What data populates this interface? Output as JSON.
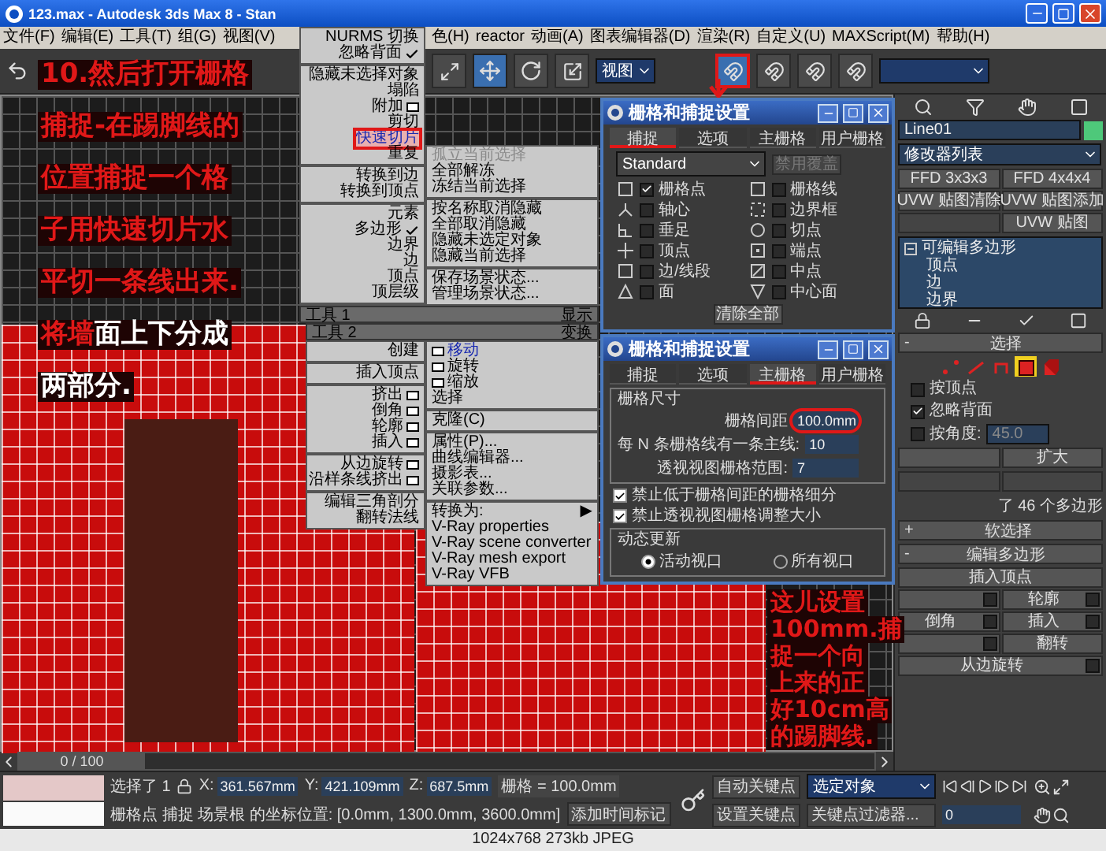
{
  "window": {
    "title": "123.max - Autodesk 3ds Max 8 - Stan"
  },
  "menu_bar": {
    "left": [
      "文件(F)",
      "编辑(E)",
      "工具(T)",
      "组(G)",
      "视图(V)"
    ],
    "right": [
      "色(H)",
      "reactor",
      "动画(A)",
      "图表编辑器(D)",
      "渲染(R)",
      "自定义(U)",
      "MAXScript(M)",
      "帮助(H)"
    ]
  },
  "toolbar": {
    "view_dropdown": "视图",
    "snap_toggles": [
      {
        "selected": true
      },
      {
        "selected": false
      },
      {
        "selected": false
      },
      {
        "selected": false
      }
    ]
  },
  "quad_menu": {
    "top_left": [
      [
        {
          "label": "NURMS 切换",
          "checked": false,
          "box": false,
          "highlighted": false,
          "disabled": false,
          "circled": false
        },
        {
          "label": "忽略背面",
          "checked": true,
          "box": false,
          "highlighted": false,
          "disabled": false,
          "circled": false
        }
      ],
      [
        {
          "label": "隐藏未选择对象",
          "checked": false,
          "box": false,
          "highlighted": false,
          "disabled": false,
          "circled": false
        },
        {
          "label": "塌陷",
          "checked": false,
          "box": false,
          "highlighted": false,
          "disabled": false,
          "circled": false
        },
        {
          "label": "附加",
          "checked": false,
          "box": true,
          "highlighted": false,
          "disabled": false,
          "circled": false
        },
        {
          "label": "剪切",
          "checked": false,
          "box": false,
          "highlighted": false,
          "disabled": false,
          "circled": false
        },
        {
          "label": "快速切片",
          "checked": false,
          "box": false,
          "highlighted": true,
          "disabled": false,
          "circled": true
        },
        {
          "label": "重复",
          "checked": false,
          "box": false,
          "highlighted": false,
          "disabled": false,
          "circled": false
        }
      ],
      [
        {
          "label": "转换到边",
          "checked": false,
          "box": false,
          "highlighted": false,
          "disabled": false,
          "circled": false
        },
        {
          "label": "转换到顶点",
          "checked": false,
          "box": false,
          "highlighted": false,
          "disabled": false,
          "circled": false
        }
      ],
      [
        {
          "label": "元素",
          "checked": false,
          "box": false,
          "highlighted": false,
          "disabled": false,
          "circled": false
        },
        {
          "label": "多边形",
          "checked": true,
          "box": false,
          "highlighted": false,
          "disabled": false,
          "circled": false
        },
        {
          "label": "边界",
          "checked": false,
          "box": false,
          "highlighted": false,
          "disabled": false,
          "circled": false
        },
        {
          "label": "边",
          "checked": false,
          "box": false,
          "highlighted": false,
          "disabled": false,
          "circled": false
        },
        {
          "label": "顶点",
          "checked": false,
          "box": false,
          "highlighted": false,
          "disabled": false,
          "circled": false
        },
        {
          "label": "顶层级",
          "checked": false,
          "box": false,
          "highlighted": false,
          "disabled": false,
          "circled": false
        }
      ]
    ],
    "top_right": [
      [
        {
          "label": "孤立当前选择",
          "checked": false,
          "box": false,
          "highlighted": false,
          "disabled": true,
          "circled": false
        },
        {
          "label": "全部解冻",
          "checked": false,
          "box": false,
          "highlighted": false,
          "disabled": false,
          "circled": false
        },
        {
          "label": "冻结当前选择",
          "checked": false,
          "box": false,
          "highlighted": false,
          "disabled": false,
          "circled": false
        }
      ],
      [
        {
          "label": "按名称取消隐藏",
          "checked": false,
          "box": false,
          "highlighted": false,
          "disabled": false,
          "circled": false
        },
        {
          "label": "全部取消隐藏",
          "checked": false,
          "box": false,
          "highlighted": false,
          "disabled": false,
          "circled": false
        },
        {
          "label": "隐藏未选定对象",
          "checked": false,
          "box": false,
          "highlighted": false,
          "disabled": false,
          "circled": false
        },
        {
          "label": "隐藏当前选择",
          "checked": false,
          "box": false,
          "highlighted": false,
          "disabled": false,
          "circled": false
        }
      ],
      [
        {
          "label": "保存场景状态...",
          "checked": false,
          "box": false,
          "highlighted": false,
          "disabled": false,
          "circled": false
        },
        {
          "label": "管理场景状态...",
          "checked": false,
          "box": false,
          "highlighted": false,
          "disabled": false,
          "circled": false
        }
      ]
    ],
    "headers": [
      {
        "left": "工具 1",
        "right": "显示"
      },
      {
        "left": "工具 2",
        "right": "变换"
      }
    ],
    "bottom_left": [
      [
        {
          "label": "创建",
          "checked": false,
          "box": false,
          "highlighted": false,
          "disabled": false,
          "circled": false
        }
      ],
      [
        {
          "label": "插入顶点",
          "checked": false,
          "box": false,
          "highlighted": false,
          "disabled": false,
          "circled": false
        }
      ],
      [
        {
          "label": "挤出",
          "checked": false,
          "box": true,
          "highlighted": false,
          "disabled": false,
          "circled": false
        },
        {
          "label": "倒角",
          "checked": false,
          "box": true,
          "highlighted": false,
          "disabled": false,
          "circled": false
        },
        {
          "label": "轮廓",
          "checked": false,
          "box": true,
          "highlighted": false,
          "disabled": false,
          "circled": false
        },
        {
          "label": "插入",
          "checked": false,
          "box": true,
          "highlighted": false,
          "disabled": false,
          "circled": false
        }
      ],
      [
        {
          "label": "从边旋转",
          "checked": false,
          "box": true,
          "highlighted": false,
          "disabled": false,
          "circled": false
        },
        {
          "label": "沿样条线挤出",
          "checked": false,
          "box": true,
          "highlighted": false,
          "disabled": false,
          "circled": false
        }
      ],
      [
        {
          "label": "编辑三角剖分",
          "checked": false,
          "box": false,
          "highlighted": false,
          "disabled": false,
          "circled": false
        },
        {
          "label": "翻转法线",
          "checked": false,
          "box": false,
          "highlighted": false,
          "disabled": false,
          "circled": false
        }
      ]
    ],
    "bottom_right": [
      [
        {
          "label": "移动",
          "checked": false,
          "box": true,
          "highlighted": true,
          "disabled": false,
          "circled": false
        },
        {
          "label": "旋转",
          "checked": false,
          "box": true,
          "highlighted": false,
          "disabled": false,
          "circled": false
        },
        {
          "label": "缩放",
          "checked": false,
          "box": true,
          "highlighted": false,
          "disabled": false,
          "circled": false
        },
        {
          "label": "选择",
          "checked": false,
          "box": false,
          "highlighted": false,
          "disabled": false,
          "circled": false
        }
      ],
      [
        {
          "label": "克隆(C)",
          "checked": false,
          "box": false,
          "highlighted": false,
          "disabled": false,
          "circled": false
        }
      ],
      [
        {
          "label": "属性(P)...",
          "checked": false,
          "box": false,
          "highlighted": false,
          "disabled": false,
          "circled": false
        },
        {
          "label": "曲线编辑器...",
          "checked": false,
          "box": false,
          "highlighted": false,
          "disabled": false,
          "circled": false
        },
        {
          "label": "摄影表...",
          "checked": false,
          "box": false,
          "highlighted": false,
          "disabled": false,
          "circled": false
        },
        {
          "label": "关联参数...",
          "checked": false,
          "box": false,
          "highlighted": false,
          "disabled": false,
          "circled": false
        }
      ],
      [
        {
          "label": "转换为:",
          "arrow": "▶",
          "checked": false,
          "box": false,
          "highlighted": false,
          "disabled": false,
          "circled": false
        },
        {
          "label": "V-Ray properties",
          "checked": false,
          "box": false,
          "highlighted": false,
          "disabled": false,
          "circled": false
        },
        {
          "label": "V-Ray scene converter",
          "checked": false,
          "box": false,
          "highlighted": false,
          "disabled": false,
          "circled": false
        },
        {
          "label": "V-Ray mesh export",
          "checked": false,
          "box": false,
          "highlighted": false,
          "disabled": false,
          "circled": false
        },
        {
          "label": "V-Ray VFB",
          "checked": false,
          "box": false,
          "highlighted": false,
          "disabled": false,
          "circled": false
        }
      ]
    ]
  },
  "snap_dialogs": [
    {
      "kind": "snaps",
      "title": "栅格和捕捉设置",
      "tabs": [
        {
          "label": "捕捉",
          "selected": true
        },
        {
          "label": "选项",
          "selected": false
        },
        {
          "label": "主栅格",
          "selected": false
        },
        {
          "label": "用户栅格",
          "selected": false
        }
      ],
      "dropdown": "Standard",
      "override_button": {
        "label": "禁用覆盖",
        "disabled": true
      },
      "snaps": [
        {
          "label": "栅格点",
          "checked": true
        },
        {
          "label": "栅格线",
          "checked": false
        },
        {
          "label": "轴心",
          "checked": false
        },
        {
          "label": "边界框",
          "checked": false
        },
        {
          "label": "垂足",
          "checked": false
        },
        {
          "label": "切点",
          "checked": false
        },
        {
          "label": "顶点",
          "checked": false
        },
        {
          "label": "端点",
          "checked": false
        },
        {
          "label": "边/线段",
          "checked": false
        },
        {
          "label": "中点",
          "checked": false
        },
        {
          "label": "面",
          "checked": false
        },
        {
          "label": "中心面",
          "checked": false
        }
      ],
      "clear_button": "清除全部"
    },
    {
      "kind": "grid",
      "title": "栅格和捕捉设置",
      "tabs": [
        {
          "label": "捕捉",
          "selected": false
        },
        {
          "label": "选项",
          "selected": false
        },
        {
          "label": "主栅格",
          "selected": true
        },
        {
          "label": "用户栅格",
          "selected": false
        }
      ],
      "group_title": "栅格尺寸",
      "fields": [
        {
          "label": "栅格间距",
          "value": "100.0mm",
          "circled": true
        },
        {
          "label": "每 N 条栅格线有一条主线:",
          "value": "10",
          "circled": false
        },
        {
          "label": "透视视图栅格范围:",
          "value": "7",
          "circled": false
        }
      ],
      "options": [
        {
          "label": "禁止低于栅格间距的栅格细分",
          "checked": true
        },
        {
          "label": "禁止透视视图栅格调整大小",
          "checked": true
        }
      ],
      "update_title": "动态更新",
      "radios": [
        {
          "label": "活动视口",
          "selected": true
        },
        {
          "label": "所有视口",
          "selected": false
        }
      ]
    }
  ],
  "command_panel": {
    "object_name": "Line01",
    "modifier_list": "修改器列表",
    "modifier_buttons": [
      {
        "label": "FFD 3x3x3",
        "disabled": false
      },
      {
        "label": "FFD 4x4x4",
        "disabled": false
      },
      {
        "label": "UVW 贴图清除",
        "disabled": false
      },
      {
        "label": "UVW 贴图添加",
        "disabled": false
      },
      {
        "disabled": true
      },
      {
        "label": "UVW 贴图",
        "disabled": false
      }
    ],
    "stack": {
      "label": "可编辑多边形",
      "expanded": true,
      "children": [
        {
          "label": "顶点"
        },
        {
          "label": "边"
        },
        {
          "label": "边界"
        }
      ]
    },
    "selection": {
      "sign": "-",
      "title": "选择",
      "levels": [
        {
          "selected": false
        },
        {
          "selected": false
        },
        {
          "selected": false
        },
        {
          "selected": true
        },
        {
          "selected": false
        }
      ],
      "checks": [
        {
          "label": "按顶点",
          "checked": false
        },
        {
          "label": "忽略背面",
          "checked": true
        },
        {
          "label": "按角度:",
          "checked": false
        }
      ],
      "angle": "45.0",
      "grow_button": "扩大",
      "info": "了 46 个多边形"
    },
    "rollouts": [
      {
        "sign": "+",
        "title": "软选择"
      },
      {
        "sign": "-",
        "title": "编辑多边形"
      }
    ],
    "edit_buttons": [
      {
        "kind": "wide",
        "label": "插入顶点",
        "box": false
      },
      {
        "kind": "half",
        "box": true
      },
      {
        "kind": "half",
        "label": "轮廓",
        "box": true
      },
      {
        "kind": "half",
        "label": "倒角",
        "box": true
      },
      {
        "kind": "half",
        "label": "插入",
        "box": true
      },
      {
        "kind": "half",
        "box": true
      },
      {
        "kind": "half",
        "label": "翻转",
        "box": false
      },
      {
        "kind": "wide",
        "label": "从边旋转",
        "box": true
      }
    ]
  },
  "time_slider": {
    "position": "0 / 100",
    "level": 0
  },
  "status": {
    "selection": "选择了 1",
    "coords": [
      {
        "axis": "X:",
        "value": "361.567mm"
      },
      {
        "axis": "Y:",
        "value": "421.109mm"
      },
      {
        "axis": "Z:",
        "value": "687.5mm"
      }
    ],
    "grid": "栅格 = 100.0mm",
    "prompt": "栅格点 捕捉 场景根 的坐标位置: [0.0mm, 1300.0mm, 3600.0mm]",
    "time_tag": "添加时间标记",
    "auto_key": "自动关键点",
    "set_key": "设置关键点",
    "key_mode": "选定对象",
    "key_filters": "关键点过滤器...",
    "frame": "0"
  },
  "annotations": {
    "left": [
      [
        {
          "text": "10.然后打开栅格",
          "emphasis": false
        }
      ],
      [
        {
          "text": "捕捉-在踢脚线的",
          "emphasis": false
        }
      ],
      [
        {
          "text": "位置捕捉一个格",
          "emphasis": false
        }
      ],
      [
        {
          "text": "子用快速切片水",
          "emphasis": false
        }
      ],
      [
        {
          "text": "平切一条线出来.",
          "emphasis": false
        }
      ],
      [
        {
          "text": "将墙",
          "emphasis": false
        },
        {
          "text": "面上下分成",
          "emphasis": true
        }
      ],
      [
        {
          "text": "两部分.",
          "emphasis": true
        }
      ]
    ],
    "right": [
      [
        {
          "text": "这儿设置",
          "emphasis": false
        }
      ],
      [
        {
          "text": "100mm.捕",
          "emphasis": false
        }
      ],
      [
        {
          "text": "捉一个向",
          "emphasis": false
        }
      ],
      [
        {
          "text": "上来的正",
          "emphasis": false
        }
      ],
      [
        {
          "text": "好10cm高",
          "emphasis": false
        }
      ],
      [
        {
          "text": "的踢脚线.",
          "emphasis": false
        }
      ]
    ]
  },
  "caption": "1024x768 273kb JPEG"
}
